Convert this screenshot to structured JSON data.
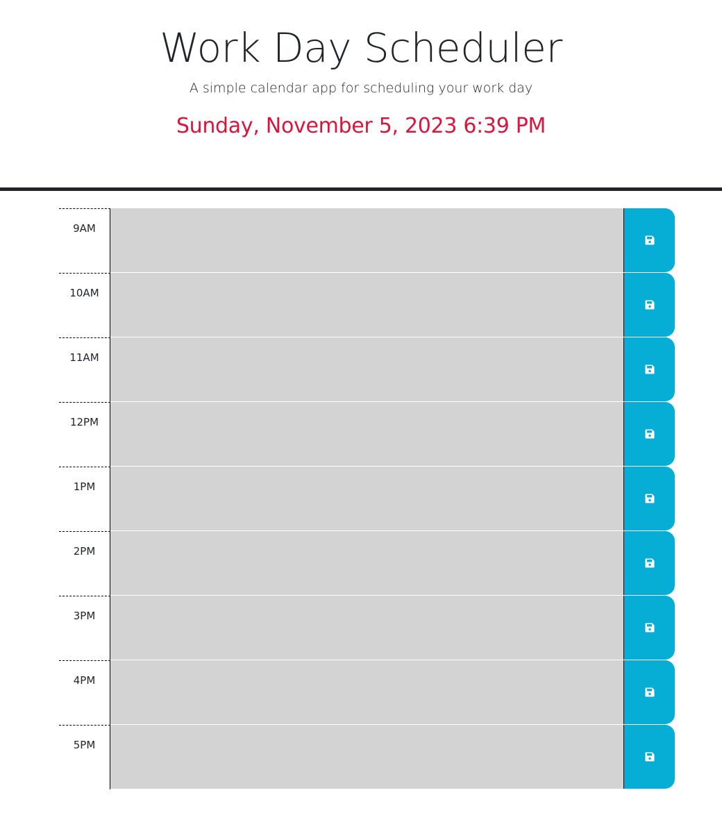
{
  "header": {
    "title": "Work Day Scheduler",
    "subtitle": "A simple calendar app for scheduling your work day",
    "current_day": "Sunday, November 5, 2023 6:39 PM"
  },
  "colors": {
    "accent": "#dc143c",
    "save_button": "#06aed5",
    "time_block_bg": "#d3d3d3",
    "divider": "#212529"
  },
  "time_blocks": [
    {
      "hour": "9AM",
      "description": "",
      "icon": "save-icon"
    },
    {
      "hour": "10AM",
      "description": "",
      "icon": "save-icon"
    },
    {
      "hour": "11AM",
      "description": "",
      "icon": "save-icon"
    },
    {
      "hour": "12PM",
      "description": "",
      "icon": "save-icon"
    },
    {
      "hour": "1PM",
      "description": "",
      "icon": "save-icon"
    },
    {
      "hour": "2PM",
      "description": "",
      "icon": "save-icon"
    },
    {
      "hour": "3PM",
      "description": "",
      "icon": "save-icon"
    },
    {
      "hour": "4PM",
      "description": "",
      "icon": "save-icon"
    },
    {
      "hour": "5PM",
      "description": "",
      "icon": "save-icon"
    }
  ]
}
